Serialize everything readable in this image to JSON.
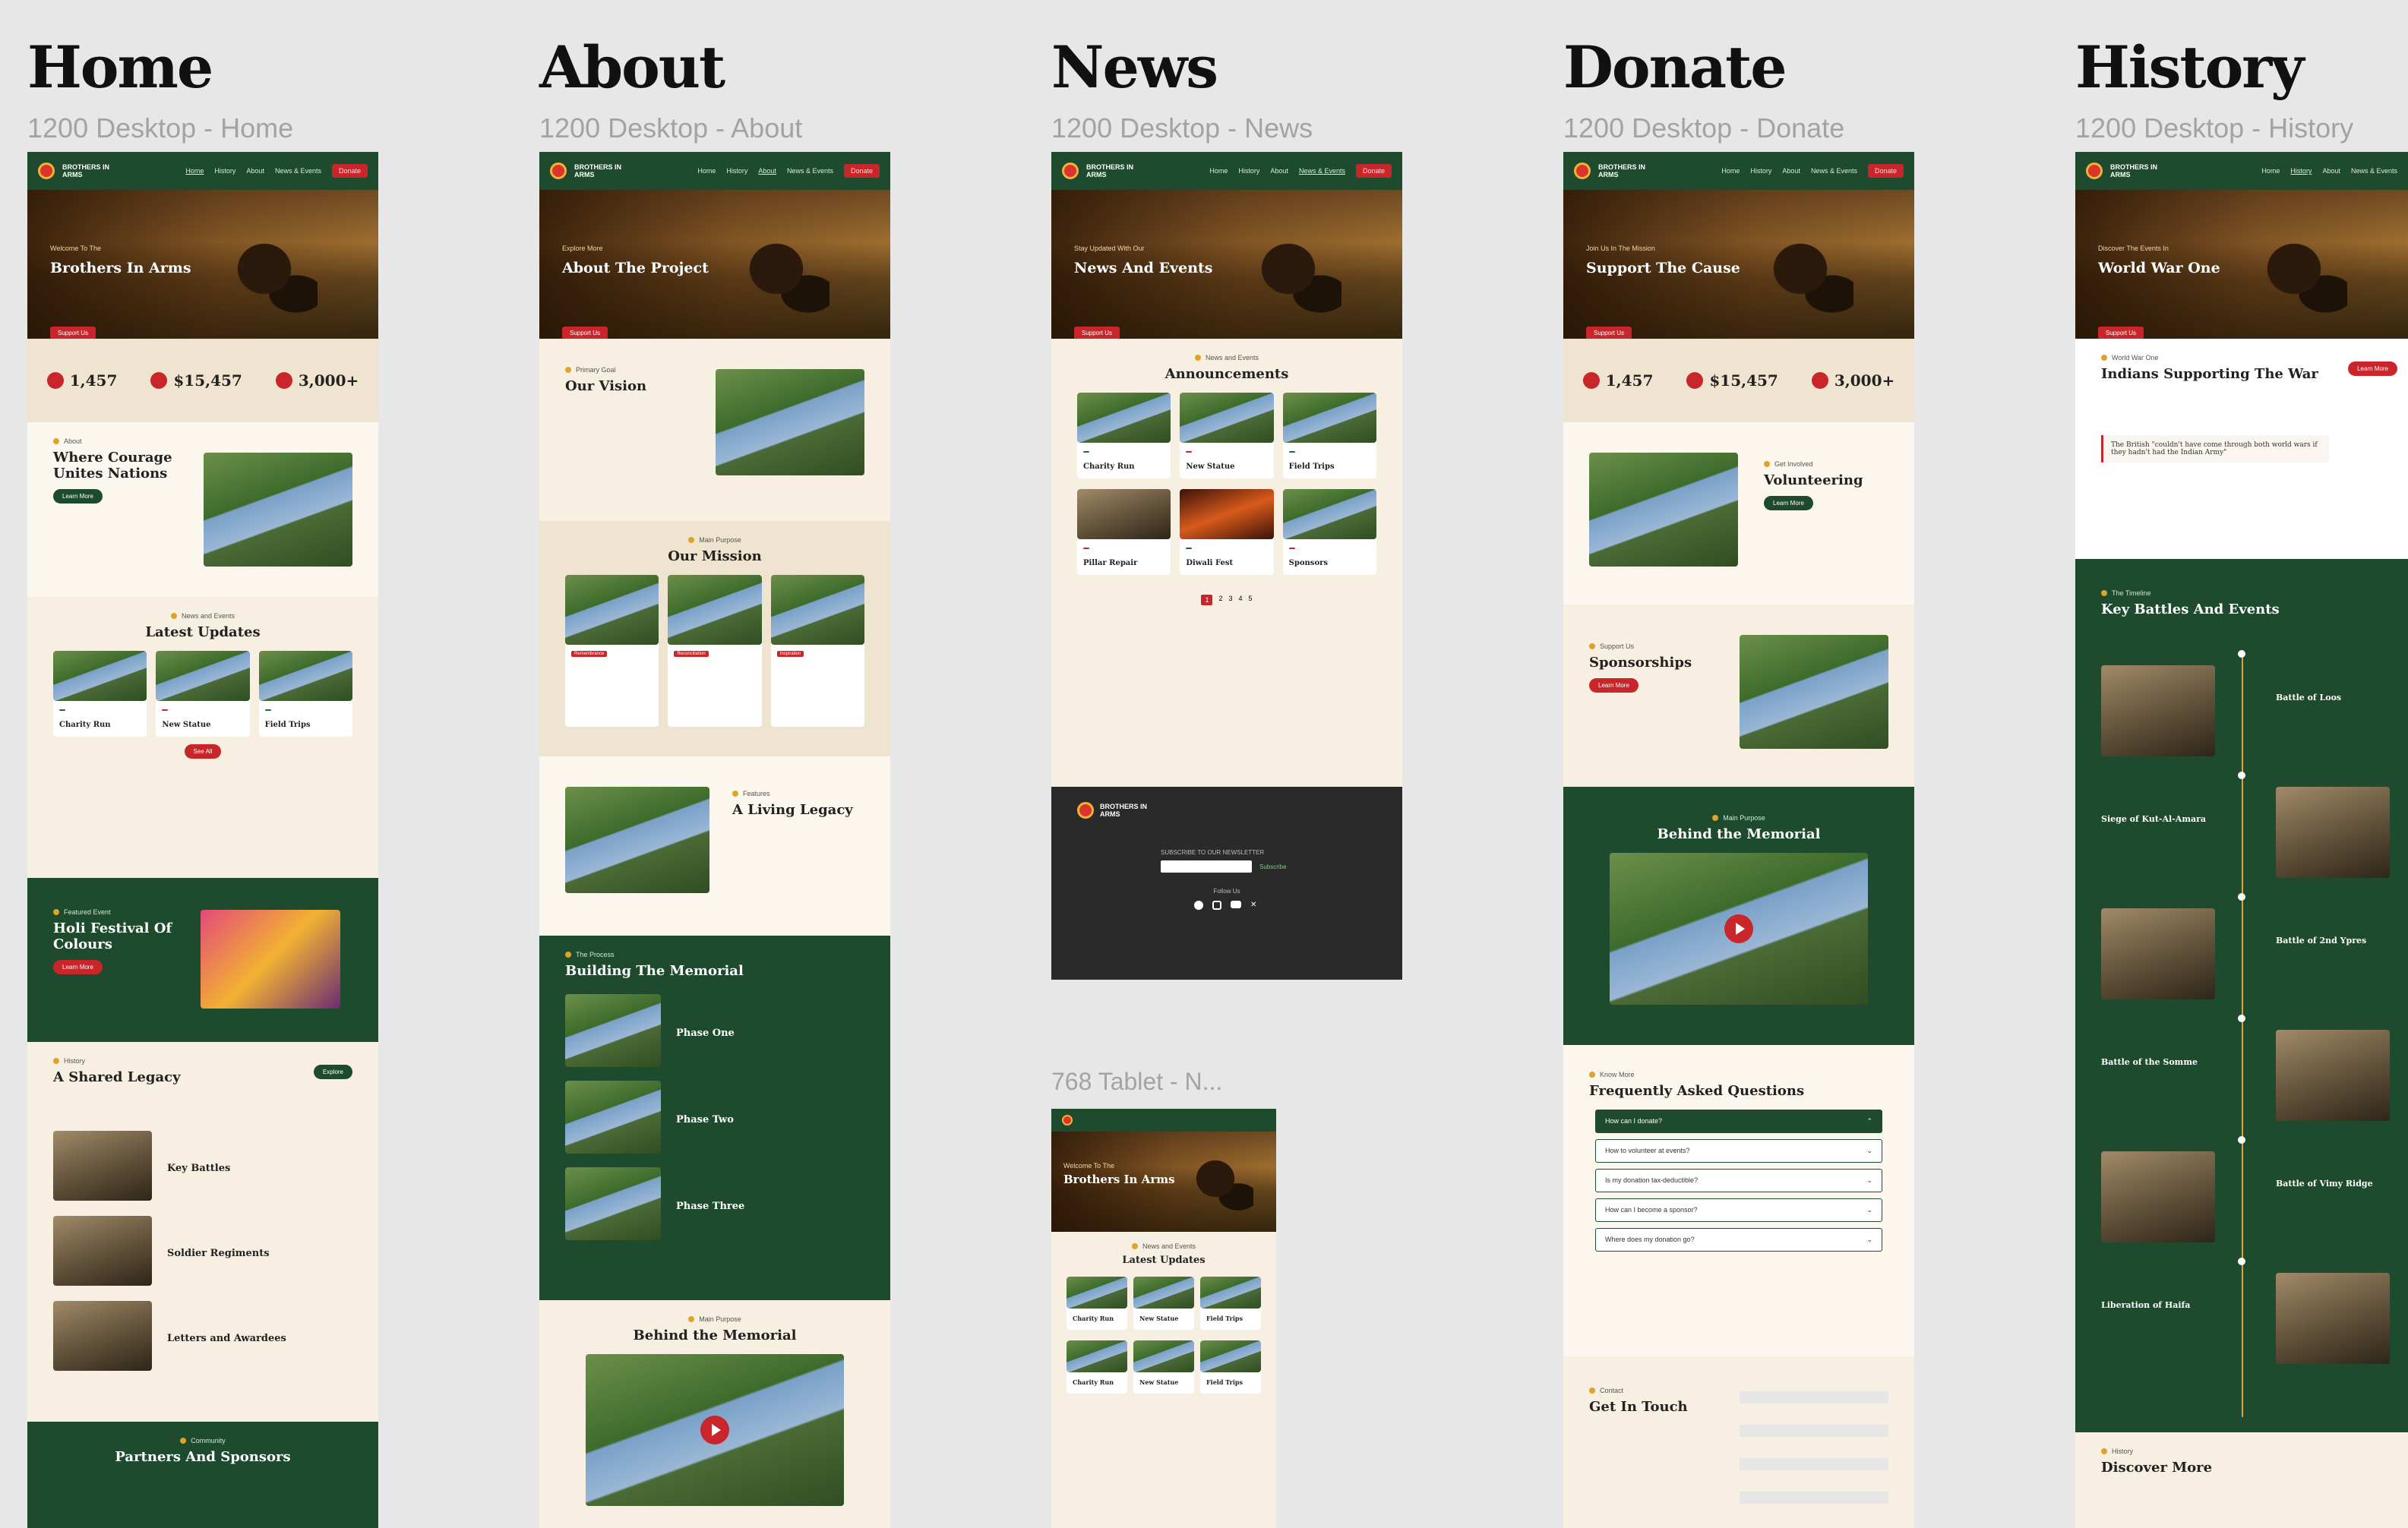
{
  "columns": [
    {
      "title": "Home",
      "subtitle": "1200 Desktop - Home"
    },
    {
      "title": "About",
      "subtitle": "1200 Desktop - About"
    },
    {
      "title": "News",
      "subtitle": "1200 Desktop - News"
    },
    {
      "title": "Donate",
      "subtitle": "1200 Desktop - Donate"
    },
    {
      "title": "History",
      "subtitle": "1200 Desktop - History"
    }
  ],
  "tablet_label": "768 Tablet - N...",
  "brand": "BROTHERS IN ARMS",
  "nav": {
    "home": "Home",
    "history": "History",
    "about": "About",
    "news": "News & Events",
    "donate": "Donate"
  },
  "home": {
    "hero_kicker": "Welcome To The",
    "hero_title": "Brothers In Arms",
    "hero_btn": "Support Us",
    "stats": [
      "1,457",
      "$15,457",
      "3,000+"
    ],
    "about_eyebrow": "About",
    "about_title": "Where Courage Unites Nations",
    "learn_more": "Learn More",
    "news_eyebrow": "News and Events",
    "news_title": "Latest Updates",
    "cards": [
      "Charity Run",
      "New Statue",
      "Field Trips"
    ],
    "see_all": "See All",
    "feat_eyebrow": "Featured Event",
    "feat_title": "Holi Festival Of Colours",
    "feat_btn": "Learn More",
    "hist_eyebrow": "History",
    "hist_title": "A Shared Legacy",
    "hist_btn": "Explore",
    "hist_items": [
      "Key Battles",
      "Soldier Regiments",
      "Letters and Awardees"
    ],
    "comm_eyebrow": "Community",
    "comm_title": "Partners And Sponsors"
  },
  "about": {
    "hero_kicker": "Explore More",
    "hero_title": "About The Project",
    "vision_eyebrow": "Primary Goal",
    "vision_title": "Our Vision",
    "mission_eyebrow": "Main Purpose",
    "mission_title": "Our Mission",
    "mission_tags": [
      "Remembrance",
      "Reconciliation",
      "Inspiration"
    ],
    "legacy_eyebrow": "Features",
    "legacy_title": "A Living Legacy",
    "process_eyebrow": "The Process",
    "process_title": "Building The Memorial",
    "phases": [
      "Phase One",
      "Phase Two",
      "Phase Three"
    ],
    "memorial_eyebrow": "Main Purpose",
    "memorial_title": "Behind the Memorial"
  },
  "news": {
    "hero_kicker": "Stay Updated With Our",
    "hero_title": "News And Events",
    "eyebrow": "News and Events",
    "title": "Announcements",
    "cards": [
      "Charity Run",
      "New Statue",
      "Field Trips",
      "Pillar Repair",
      "Diwali Fest",
      "Sponsors"
    ],
    "pages": [
      "1",
      "2",
      "3",
      "4",
      "5"
    ],
    "footer_newsletter": "SUBSCRIBE TO OUR NEWSLETTER",
    "footer_btn": "Subscribe",
    "footer_follow": "Follow Us"
  },
  "donate": {
    "hero_kicker": "Join Us In The Mission",
    "hero_title": "Support The Cause",
    "stats": [
      "1,457",
      "$15,457",
      "3,000+"
    ],
    "vol_eyebrow": "Get Involved",
    "vol_title": "Volunteering",
    "spon_eyebrow": "Support Us",
    "spon_title": "Sponsorships",
    "mem_eyebrow": "Main Purpose",
    "mem_title": "Behind the Memorial",
    "faq_eyebrow": "Know More",
    "faq_title": "Frequently Asked Questions",
    "faqs": [
      "How can I donate?",
      "How to volunteer at events?",
      "Is my donation tax-deductible?",
      "How can I become a sponsor?",
      "Where does my donation go?"
    ],
    "contact_eyebrow": "Contact",
    "contact_title": "Get In Touch"
  },
  "history": {
    "hero_kicker": "Discover The Events In",
    "hero_title": "World War One",
    "ww_eyebrow": "World War One",
    "ww_title": "Indians Supporting The War",
    "ww_btn": "Learn More",
    "quote": "The British \"couldn't have come through both world wars if they hadn't had the Indian Army\"",
    "tl_eyebrow": "The Timeline",
    "tl_title": "Key Battles And Events",
    "battles": [
      "Battle of Loos",
      "Siege of Kut-Al-Amara",
      "Battle of 2nd Ypres",
      "Battle of the Somme",
      "Battle of Vimy Ridge",
      "Liberation of Haifa"
    ],
    "disc_eyebrow": "History",
    "disc_title": "Discover More"
  },
  "tablet": {
    "hero_kicker": "Welcome To The",
    "hero_title": "Brothers In Arms",
    "eyebrow": "News and Events",
    "title": "Latest Updates",
    "cards": [
      "Charity Run",
      "New Statue",
      "Field Trips"
    ]
  }
}
